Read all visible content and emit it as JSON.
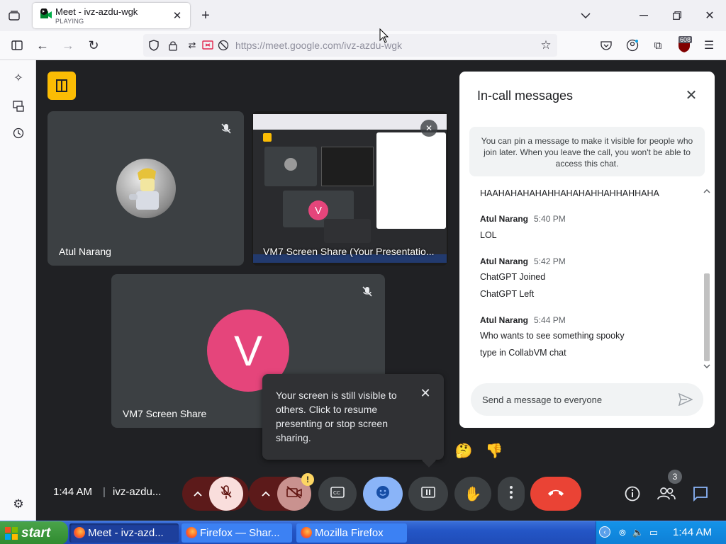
{
  "browser": {
    "tab_title": "Meet - ivz-azdu-wgk",
    "tab_status": "PLAYING",
    "url": "https://meet.google.com/ivz-azdu-wgk",
    "extension_badge": "608"
  },
  "tiles": [
    {
      "name": "Atul Narang"
    },
    {
      "name": "VM7 Screen Share (Your Presentatio..."
    },
    {
      "name": "VM7 Screen Share",
      "initial": "V"
    }
  ],
  "chat": {
    "title": "In-call messages",
    "note": "You can pin a message to make it visible for people who join later. When you leave the call, you won't be able to access this chat.",
    "first_line": "HAAHAHAHAHAHHAHAHAHHAHHAHHAHA",
    "groups": [
      {
        "sender": "Atul Narang",
        "time": "5:40 PM",
        "lines": [
          "LOL"
        ]
      },
      {
        "sender": "Atul Narang",
        "time": "5:42 PM",
        "lines": [
          "ChatGPT Joined",
          "ChatGPT Left"
        ]
      },
      {
        "sender": "Atul Narang",
        "time": "5:44 PM",
        "lines": [
          "Who wants to see something spooky",
          "type in CollabVM chat"
        ]
      }
    ],
    "input_placeholder": "Send a message to everyone"
  },
  "tooltip": {
    "text": "Your screen is still visible to others. Click to resume presenting or stop screen sharing."
  },
  "controls": {
    "time": "1:44 AM",
    "separator": "|",
    "meeting_code": "ivz-azdu...",
    "people_count": "3",
    "camera_alert": "!"
  },
  "taskbar": {
    "start": "start",
    "buttons": [
      "Meet - ivz-azd...",
      "Firefox — Shar...",
      "Mozilla Firefox"
    ],
    "clock": "1:44 AM"
  },
  "colors": {
    "accent_blue": "#8ab4f8",
    "red": "#ea4335",
    "avatar_pink": "#e5457b",
    "dark_red": "#5c1a1a"
  }
}
